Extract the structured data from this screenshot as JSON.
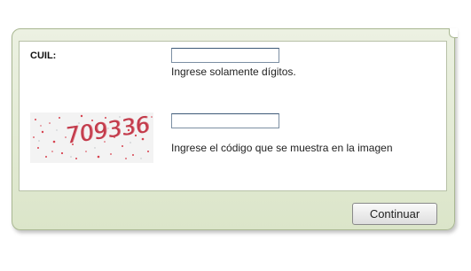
{
  "form": {
    "cuil_label": "CUIL:",
    "cuil_value": "",
    "cuil_hint": "Ingrese solamente dígitos.",
    "captcha_image_text": "709336",
    "captcha_value": "",
    "captcha_hint": "Ingrese el código que se muestra en la imagen",
    "submit_label": "Continuar"
  },
  "colors": {
    "frame_background": "#e3ead6",
    "frame_border": "#a9b792",
    "captcha_digits": "#c23b4b"
  }
}
